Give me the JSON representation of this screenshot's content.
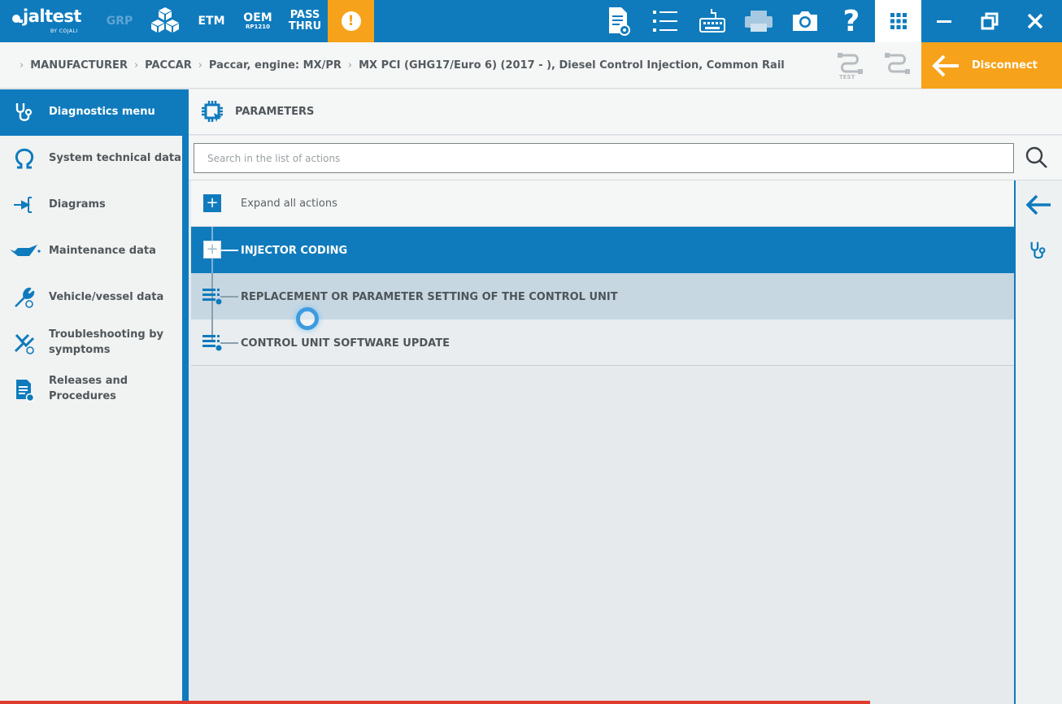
{
  "colors": {
    "primary": "#0f7bbd",
    "accent": "#f7a21b",
    "panel": "#f5f6f6",
    "text": "#50575b"
  },
  "topbar": {
    "logo_name": "jaltest",
    "logo_by": "BY COJALI",
    "grp": "GRP",
    "etm": "ETM",
    "oem": "OEM",
    "oem_sub": "RP1210",
    "pass": "PASS",
    "thru": "THRU",
    "alert": "!",
    "icons": [
      "cube-icon",
      "report-icon",
      "list-icon",
      "keyboard-icon",
      "printer-icon",
      "camera-icon",
      "help-icon",
      "apps-icon",
      "minimize-icon",
      "restore-icon",
      "close-icon"
    ],
    "help": "?"
  },
  "breadcrumb": {
    "items": [
      "MANUFACTURER",
      "PACCAR",
      "Paccar, engine: MX/PR",
      "MX PCI (GHG17/Euro 6) (2017 - ), Diesel Control Injection, Common Rail"
    ],
    "test_label": "TEST"
  },
  "disconnect": {
    "label": "Disconnect"
  },
  "sidebar": {
    "items": [
      {
        "label": "Diagnostics menu",
        "icon": "stethoscope-icon"
      },
      {
        "label": "System technical data",
        "icon": "omega-icon"
      },
      {
        "label": "Diagrams",
        "icon": "diagram-icon"
      },
      {
        "label": "Maintenance data",
        "icon": "oil-can-icon"
      },
      {
        "label": "Vehicle/vessel data",
        "icon": "wrench-icon"
      },
      {
        "label": "Troubleshooting by",
        "label2": "symptoms",
        "icon": "tools-icon"
      },
      {
        "label": "Releases and",
        "label2": "Procedures",
        "icon": "document-icon"
      }
    ]
  },
  "main": {
    "title": "PARAMETERS",
    "search_placeholder": "Search in the list of actions",
    "expand_label": "Expand all actions",
    "rows": [
      {
        "label": "INJECTOR CODING"
      },
      {
        "label": "REPLACEMENT OR PARAMETER SETTING OF THE CONTROL UNIT"
      },
      {
        "label": "CONTROL UNIT SOFTWARE UPDATE"
      }
    ]
  }
}
